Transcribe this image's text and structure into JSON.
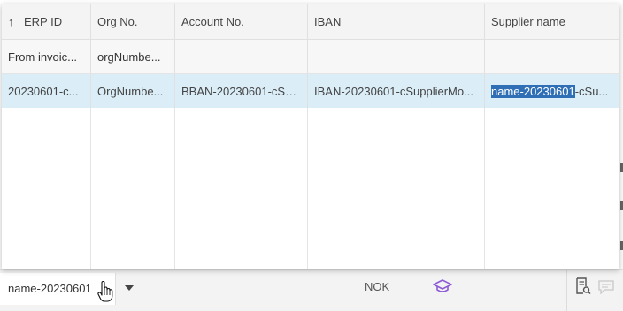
{
  "popup": {
    "columns": [
      {
        "label": "ERP ID",
        "sorted": "ascending"
      },
      {
        "label": "Org No."
      },
      {
        "label": "Account No."
      },
      {
        "label": "IBAN"
      },
      {
        "label": "Supplier name"
      }
    ],
    "filter_row": [
      "From invoic...",
      "orgNumbe...",
      "",
      "",
      ""
    ],
    "rows": [
      {
        "erp_id": "20230601-c...",
        "org_no": "OrgNumbe...",
        "account_no": "BBAN-20230601-cSu...",
        "iban": "IBAN-20230601-cSupplierMo...",
        "supplier_name_highlight": "name-20230601",
        "supplier_name_rest": "-cSu..."
      }
    ]
  },
  "background": {
    "supplier_input_value": "name-20230601",
    "currency": "NOK"
  },
  "colors": {
    "selected_row": "#dbeef8",
    "text_highlight": "#2f6fb5",
    "academy_icon": "#8e5bd6"
  }
}
